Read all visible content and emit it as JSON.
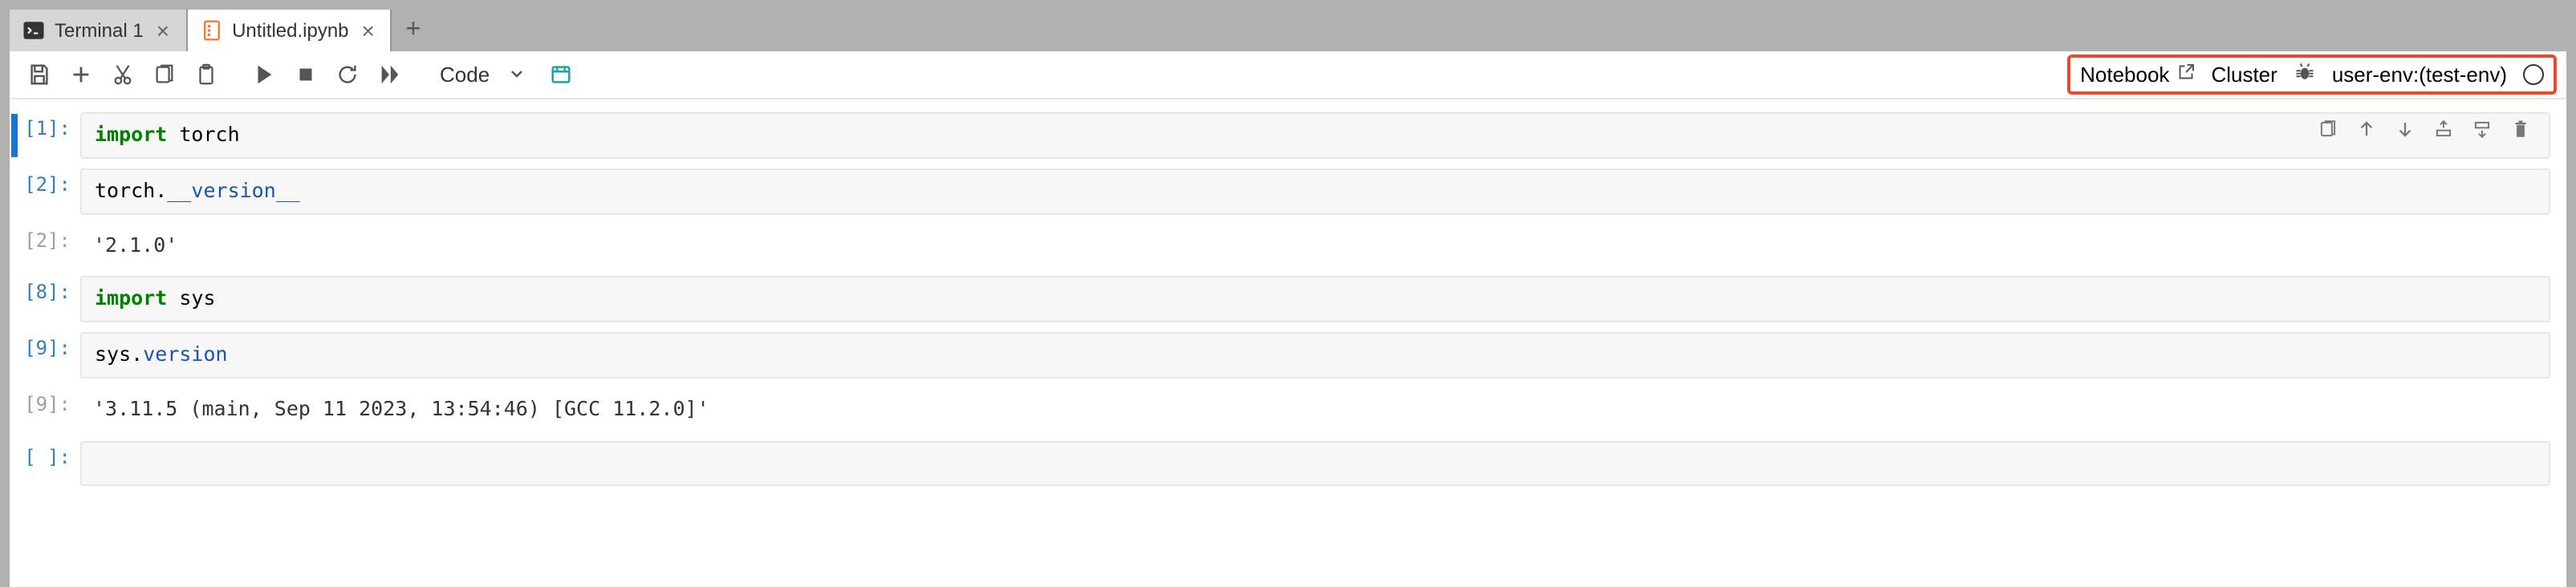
{
  "tabs": [
    {
      "title": "Terminal 1",
      "icon": "terminal"
    },
    {
      "title": "Untitled.ipynb",
      "icon": "notebook"
    }
  ],
  "toolbar": {
    "cell_type": "Code"
  },
  "kernel": {
    "notebook_label": "Notebook",
    "cluster_label": "Cluster",
    "name": "user-env:(test-env)"
  },
  "cells": [
    {
      "type": "code",
      "exec": "1",
      "selected": true,
      "tokens": [
        {
          "t": "kw",
          "v": "import"
        },
        {
          "t": "",
          "v": " torch"
        }
      ]
    },
    {
      "type": "code",
      "exec": "2",
      "tokens": [
        {
          "t": "",
          "v": "torch."
        },
        {
          "t": "attr",
          "v": "__version__"
        }
      ]
    },
    {
      "type": "output",
      "exec": "2",
      "text": "'2.1.0'"
    },
    {
      "type": "code",
      "exec": "8",
      "tokens": [
        {
          "t": "kw",
          "v": "import"
        },
        {
          "t": "",
          "v": " sys"
        }
      ]
    },
    {
      "type": "code",
      "exec": "9",
      "tokens": [
        {
          "t": "",
          "v": "sys."
        },
        {
          "t": "attr",
          "v": "version"
        }
      ]
    },
    {
      "type": "output",
      "exec": "9",
      "text": "'3.11.5 (main, Sep 11 2023, 13:54:46) [GCC 11.2.0]'"
    },
    {
      "type": "code",
      "exec": "",
      "tokens": []
    }
  ],
  "cell_tool_icons": [
    "duplicate",
    "up",
    "down",
    "insert-above",
    "insert-below",
    "delete"
  ]
}
